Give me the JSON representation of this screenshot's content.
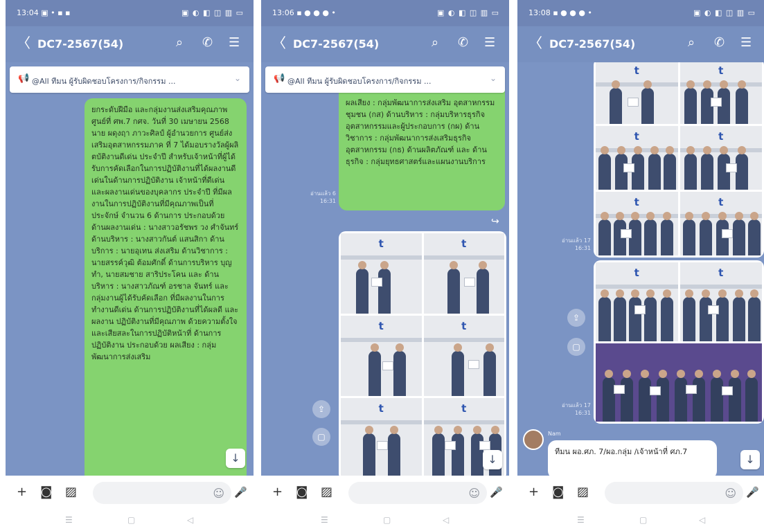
{
  "status": {
    "time_1": "13:04 ▣ • ▪ ▪",
    "time_2": "13:06 ▪ ● ● ● •",
    "time_3": "13:08 ▪ ● ● ● •",
    "icons": "▣ ◐ ◧ ◫ ▥ ▭"
  },
  "header": {
    "title": "DC7-2567(54)",
    "back": "〈",
    "search": "⌕",
    "call": "✆",
    "menu": "☰"
  },
  "announcement": {
    "text": "@All ทีมน ผู้รับผิดชอบโครงการ/กิจกรรม ...",
    "icon": "📢",
    "chevron": "⌄"
  },
  "panel1": {
    "message": "ยกระดับฝีมือ และกลุ่มงานส่งเสริมคุณภาพ ศูนย์ที่ ศพ.7 กศจ. วันที่ 30 เมษายน 2568 นาย ผดุงฤา ภาวะศิลป์ ผู้อำนวยการ ศูนย์ส่งเสริมอุตสาหกรรมภาค ที่ 7 ได้มอบรางวัลผู้ผลิตบัติงานดีเด่น ประจำปี สำหรับเจ้าหน้าที่ผู้ได้รับการคัดเลือกในการปฏิบัติงานที่ได้ผลงานดีเด่นในด้านการปฏิบัติงาน เจ้าหน้าที่ดีเด่น และผลงานเด่นของบุคลากร ประจำปี ที่มีผลงานในการปฏิบัติงานที่มีคุณภาพเป็นที่ประจักษ์ จำนวน 6 ด้านการ ประกอบด้วย ด้านผลงานเด่น : นางสาวอรัชพร วง ศำจันทร์ ด้านบริหาร : นางสาวกันต์ แสนสิกา ด้านบริการ : นายอุเทน ส่งเสริม ด้านวิชาการ : นายสรรค์วุฒิ ต้อมศักดิ์ ด้านการบริหาร บุญทำ, นายสมชาย สาริประโคน และ ด้านบริหาร : นางสาวภัณฑ์ อรชาล จันทร์ และกลุ่มงานผู้ได้รับคัดเลือก ที่มีผลงานในการทำงานดีเด่น ด้านการปฏิบัติงานที่ได้ผลดี และผลงาน ปฏิบัติงานที่มีคุณภาพ ด้วยความตั้งใจ และเสียสละในการปฏิบัติหน้าที่ ด้านการปฏิบัติงาน ประกอบด้วย ผลเสียง : กลุ่มพัฒนาการส่งเสริม",
    "down": "↓"
  },
  "panel2": {
    "message": "ผลเสียง : กลุ่มพัฒนาการส่งเสริม อุตสาหกรรมชุมชน (กส) ด้านบริหาร : กลุ่มบริหารธุรกิจอุตสาหกรรมและผู้ประกอบการ (กผ) ด้านวิชาการ : กลุ่มพัฒนาการส่งเสริมธุรกิจ อุตสาหกรรม (กธ) ด้านผลิตภัณฑ์ และ ด้านธุรกิจ : กลุ่มยุทธศาสตร์และแผนงานบริการ",
    "time": "อ่านแล้ว 6 16:31",
    "share": "⇪",
    "save": "▢",
    "forward": "↪",
    "down": "↓"
  },
  "panel3": {
    "time_a": "อ่านแล้ว 17 16:31",
    "time_b": "อ่านแล้ว 17 16:31",
    "sender": "Nam",
    "reply": "ทีมน ผอ.ศภ. 7/ผอ.กลุ่ม /เจ้าหน้าที่ ศภ.7",
    "share": "⇪",
    "save": "▢",
    "down": "↓"
  },
  "inputbar": {
    "plus": "+",
    "camera": "◙",
    "image": "▨",
    "emoji": "☺",
    "mic": "🎤"
  },
  "navbar": {
    "menu": "☰",
    "home": "▢",
    "back": "◁"
  }
}
